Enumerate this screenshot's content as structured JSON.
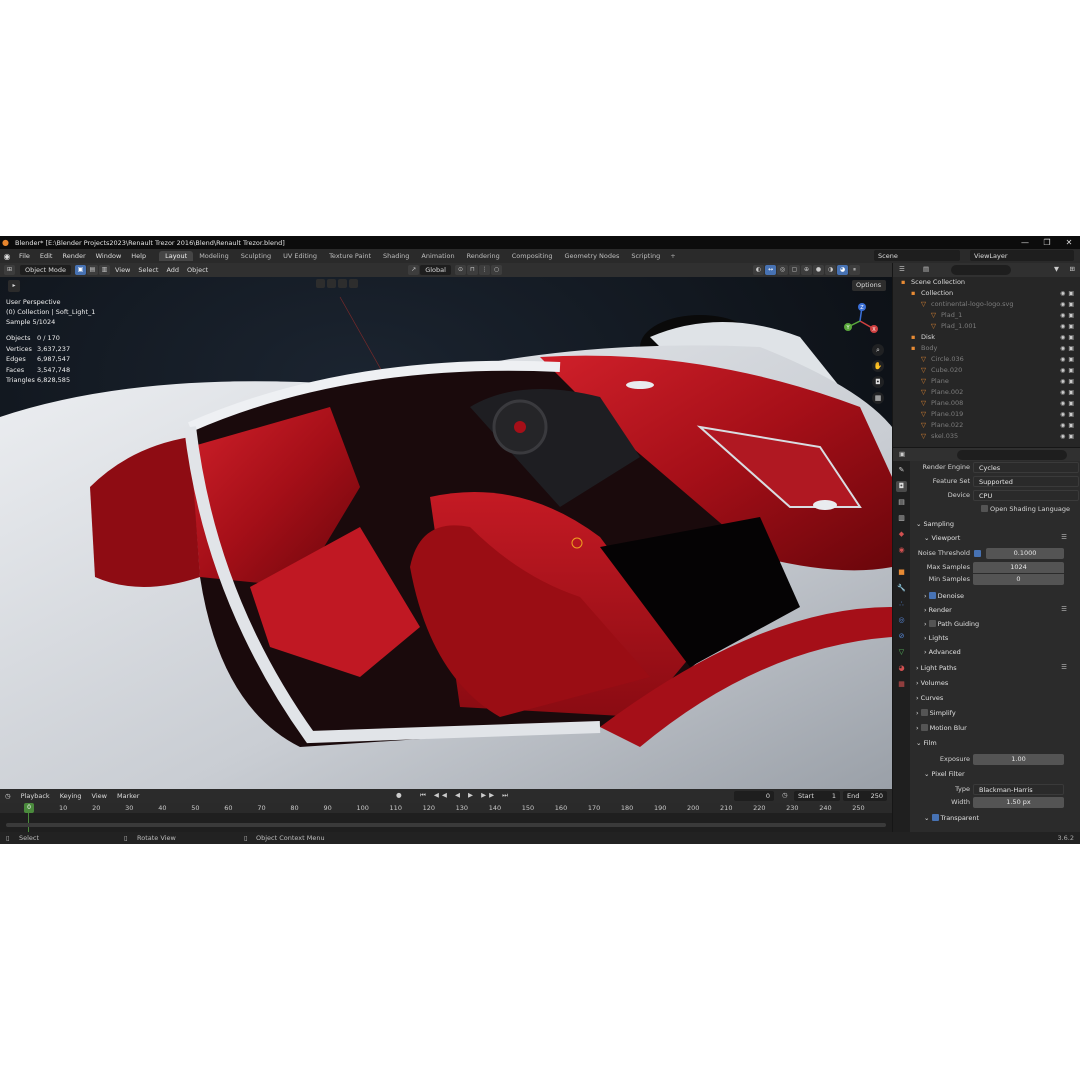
{
  "window": {
    "title": "Blender* [E:\\Blender Projects2023\\Renault Trezor 2016\\Blend\\Renault Trezor.blend]",
    "controls": [
      "—",
      "❐",
      "✕"
    ]
  },
  "menubar": {
    "items": [
      "File",
      "Edit",
      "Render",
      "Window",
      "Help"
    ],
    "workspaces": [
      "Layout",
      "Modeling",
      "Sculpting",
      "UV Editing",
      "Texture Paint",
      "Shading",
      "Animation",
      "Rendering",
      "Compositing",
      "Geometry Nodes",
      "Scripting"
    ],
    "active_workspace": "Layout",
    "scene": "Scene",
    "view_layer": "ViewLayer"
  },
  "viewport_header": {
    "mode": "Object Mode",
    "menus": [
      "View",
      "Select",
      "Add",
      "Object"
    ],
    "orientation": "Global",
    "options": "Options"
  },
  "viewport": {
    "view_name": "User Perspective",
    "collection_line": "(0) Collection | Soft_Light_1",
    "sample": "Sample 5/1024",
    "stats": [
      {
        "k": "Objects",
        "v": "0 / 170"
      },
      {
        "k": "Vertices",
        "v": "3,637,237"
      },
      {
        "k": "Edges",
        "v": "6,987,547"
      },
      {
        "k": "Faces",
        "v": "3,547,748"
      },
      {
        "k": "Triangles",
        "v": "6,828,585"
      }
    ],
    "gizmo": {
      "x": "X",
      "y": "Y",
      "z": "Z"
    }
  },
  "timeline": {
    "menus": [
      "Playback",
      "Keying",
      "View",
      "Marker"
    ],
    "current_frame": "0",
    "start_label": "Start",
    "start": "1",
    "end_label": "End",
    "end": "250",
    "ticks": [
      "0",
      "10",
      "20",
      "30",
      "40",
      "50",
      "60",
      "70",
      "80",
      "90",
      "100",
      "110",
      "120",
      "130",
      "140",
      "150",
      "160",
      "170",
      "180",
      "190",
      "200",
      "210",
      "220",
      "230",
      "240",
      "250"
    ]
  },
  "statusbar": {
    "select": "Select",
    "rotate": "Rotate View",
    "context": "Object Context Menu",
    "version": "3.6.2"
  },
  "outliner": {
    "rows": [
      {
        "label": "Scene Collection",
        "indent": 0,
        "dim": false
      },
      {
        "label": "Collection",
        "indent": 1,
        "dim": false
      },
      {
        "label": "continental-logo-logo.svg",
        "indent": 2,
        "dim": true
      },
      {
        "label": "Plad_1",
        "indent": 3,
        "dim": true
      },
      {
        "label": "Plad_1.001",
        "indent": 3,
        "dim": true
      },
      {
        "label": "Disk",
        "indent": 1,
        "dim": false
      },
      {
        "label": "Body",
        "indent": 1,
        "dim": true
      },
      {
        "label": "Circle.036",
        "indent": 2,
        "dim": true
      },
      {
        "label": "Cube.020",
        "indent": 2,
        "dim": true
      },
      {
        "label": "Plane",
        "indent": 2,
        "dim": true
      },
      {
        "label": "Plane.002",
        "indent": 2,
        "dim": true
      },
      {
        "label": "Plane.008",
        "indent": 2,
        "dim": true
      },
      {
        "label": "Plane.019",
        "indent": 2,
        "dim": true
      },
      {
        "label": "Plane.022",
        "indent": 2,
        "dim": true
      },
      {
        "label": "skel.035",
        "indent": 2,
        "dim": true
      }
    ]
  },
  "properties": {
    "render_engine_label": "Render Engine",
    "render_engine": "Cycles",
    "feature_set_label": "Feature Set",
    "feature_set": "Supported",
    "device_label": "Device",
    "device": "CPU",
    "osl": "Open Shading Language",
    "sampling": "Sampling",
    "viewport": "Viewport",
    "noise_threshold_label": "Noise Threshold",
    "noise_threshold": "0.1000",
    "max_samples_label": "Max Samples",
    "max_samples": "1024",
    "min_samples_label": "Min Samples",
    "min_samples": "0",
    "denoise": "Denoise",
    "render": "Render",
    "path_guiding": "Path Guiding",
    "lights": "Lights",
    "advanced": "Advanced",
    "light_paths": "Light Paths",
    "volumes": "Volumes",
    "curves": "Curves",
    "simplify": "Simplify",
    "motion_blur": "Motion Blur",
    "film": "Film",
    "exposure_label": "Exposure",
    "exposure": "1.00",
    "pixel_filter": "Pixel Filter",
    "type_label": "Type",
    "type": "Blackman-Harris",
    "width_label": "Width",
    "width": "1.50 px",
    "transparent": "Transparent"
  },
  "colors": {
    "accent": "#4772b3",
    "active_frame": "#4a8a3c",
    "car_red": "#b3121a",
    "car_body": "#d9dde2"
  }
}
